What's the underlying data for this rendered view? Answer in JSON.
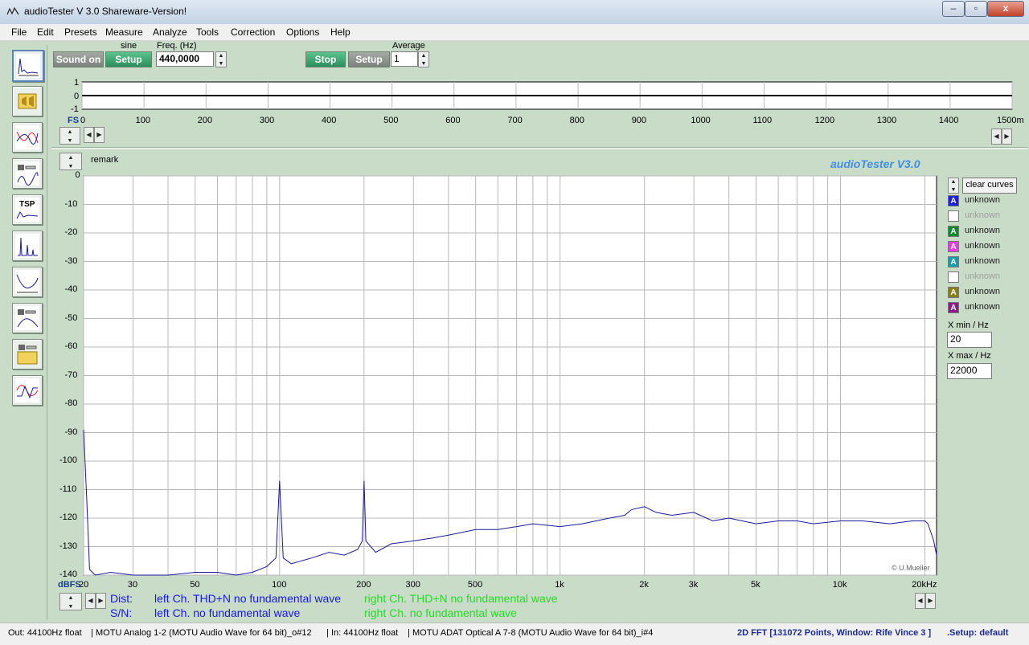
{
  "window": {
    "title": "audioTester  V 3.0 Shareware-Version!",
    "controls": [
      "–",
      "▫",
      "x"
    ]
  },
  "menu": [
    "File",
    "Edit",
    "Presets",
    "Measure",
    "Analyze",
    "Tools",
    "Correction",
    "Options",
    "Help"
  ],
  "generator": {
    "sound_button": "Sound on",
    "wave_label": "sine",
    "setup_button": "Setup",
    "freq_label": "Freq. (Hz)",
    "freq_value": "440,0000"
  },
  "analyzer": {
    "stop_button": "Stop",
    "setup_button": "Setup",
    "average_label": "Average",
    "average_value": "1"
  },
  "scope": {
    "y_ticks": [
      "1",
      "0",
      "-1"
    ],
    "fs_label": "FS",
    "x_ticks": [
      "0",
      "100",
      "200",
      "300",
      "400",
      "500",
      "600",
      "700",
      "800",
      "900",
      "1000",
      "1100",
      "1200",
      "1300",
      "1400",
      "1500m"
    ]
  },
  "main": {
    "remark": "remark",
    "brand": "audioTester  V3.0",
    "copyright": "© U.Mueller",
    "unit_label": "dBFS",
    "x_right_label": "20kHz"
  },
  "chart_data": {
    "type": "line",
    "xscale": "log",
    "xlim": [
      20,
      22000
    ],
    "ylim": [
      -140,
      0
    ],
    "grid": true,
    "x_ticks": [
      "20",
      "30",
      "50",
      "100",
      "200",
      "300",
      "500",
      "1k",
      "2k",
      "3k",
      "5k",
      "10k",
      "20kHz"
    ],
    "y_ticks": [
      "0",
      "-10",
      "-20",
      "-30",
      "-40",
      "-50",
      "-60",
      "-70",
      "-80",
      "-90",
      "-100",
      "-110",
      "-120",
      "-130",
      "-140"
    ],
    "ylabel": "dBFS",
    "color": "#1a1a9c",
    "x": [
      20,
      20.5,
      21,
      22,
      25,
      30,
      40,
      50,
      60,
      70,
      80,
      90,
      97,
      100,
      103,
      110,
      130,
      150,
      170,
      190,
      197,
      200,
      203,
      220,
      250,
      300,
      350,
      400,
      500,
      600,
      700,
      800,
      1000,
      1200,
      1500,
      1700,
      1800,
      2000,
      2200,
      2500,
      3000,
      3500,
      4000,
      5000,
      6000,
      7000,
      8000,
      10000,
      12000,
      15000,
      18000,
      20000,
      20500,
      21500,
      22000
    ],
    "y": [
      -89,
      -112,
      -138,
      -140,
      -139,
      -140,
      -140,
      -139,
      -139,
      -140,
      -139,
      -137,
      -134,
      -107,
      -134,
      -136,
      -134,
      -132,
      -133,
      -131,
      -128,
      -107,
      -128,
      -132,
      -129,
      -128,
      -127,
      -126,
      -124,
      -124,
      -123,
      -122,
      -123,
      -122,
      -120,
      -119,
      -117,
      -116,
      -118,
      -119,
      -118,
      -121,
      -120,
      -122,
      -121,
      -121,
      -122,
      -121,
      -121,
      -122,
      -121,
      -121,
      -122,
      -128,
      -133
    ]
  },
  "legend": {
    "clear_button": "clear curves",
    "entries": [
      {
        "label": "unknown",
        "color": "#1e1ee0",
        "enabled": true
      },
      {
        "label": "unknown",
        "color": "#ffffff",
        "enabled": false
      },
      {
        "label": "unknown",
        "color": "#0e8a2c",
        "enabled": true
      },
      {
        "label": "unknown",
        "color": "#e83de0",
        "enabled": true
      },
      {
        "label": "unknown",
        "color": "#1c9ab0",
        "enabled": true
      },
      {
        "label": "unknown",
        "color": "#ffffff",
        "enabled": false
      },
      {
        "label": "unknown",
        "color": "#8a7d18",
        "enabled": true
      },
      {
        "label": "unknown",
        "color": "#8a1c8a",
        "enabled": true
      }
    ],
    "xmin_label": "X min / Hz",
    "xmin_value": "20",
    "xmax_label": "X max / Hz",
    "xmax_value": "22000"
  },
  "dist": {
    "dist_label": "Dist:",
    "sn_label": "S/N:",
    "left_dist": "left Ch. THD+N  no fundamental wave",
    "left_sn": "left Ch.  no fundamental wave",
    "right_dist": "right Ch. THD+N  no fundamental wave",
    "right_sn": "right Ch.  no fundamental wave"
  },
  "status": {
    "out": "Out: 44100Hz float",
    "out_device": "MOTU Analog 1-2 (MOTU Audio Wave for 64 bit)_o#12",
    "in": "In: 44100Hz float",
    "in_device": "MOTU ADAT Optical A 7-8 (MOTU Audio Wave for 64 bit)_i#4",
    "mode": "2D FFT [131072 Points, Window: Rife Vince 3 ]",
    "setup": ".Setup:  default"
  }
}
